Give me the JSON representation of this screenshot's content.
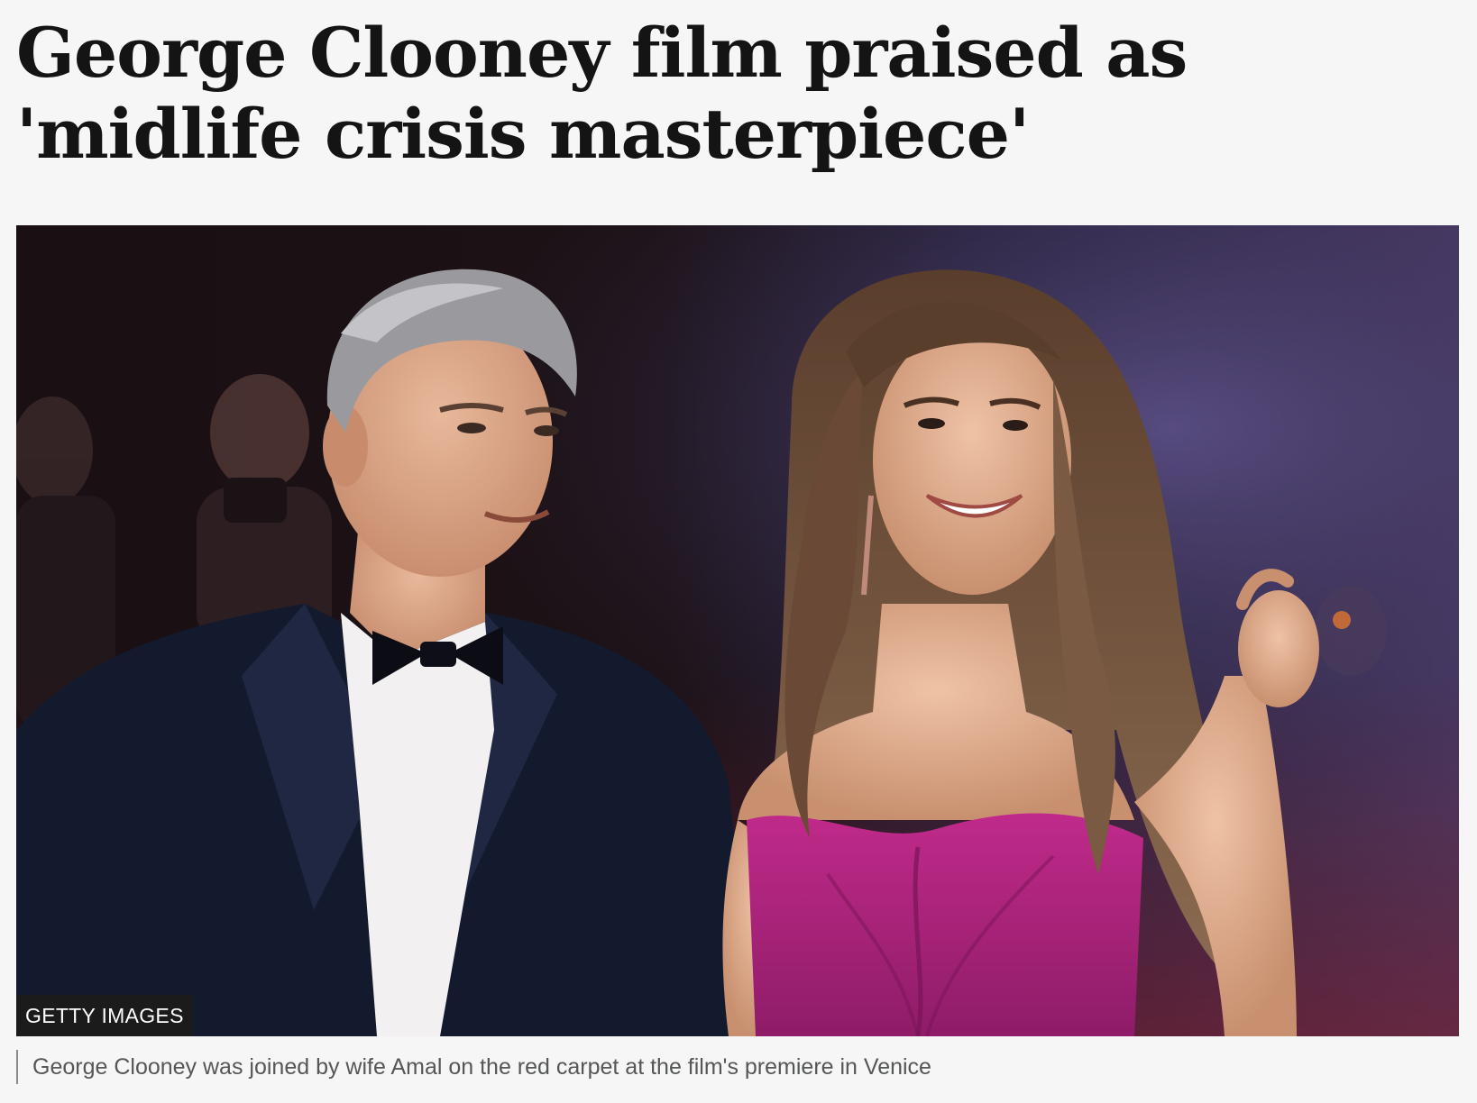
{
  "article": {
    "headline_line1": "George Clooney film praised as",
    "headline_line2": "'midlife crisis masterpiece'"
  },
  "image": {
    "credit": "GETTY IMAGES",
    "caption": "George Clooney was joined by wife Amal on the red carpet at the film's premiere in Venice"
  },
  "colors": {
    "page_background": "#f6f6f6",
    "headline_text": "#141414",
    "caption_text": "#545658",
    "credit_background": "#1b1b1b",
    "dress_magenta": "#b4247e"
  }
}
